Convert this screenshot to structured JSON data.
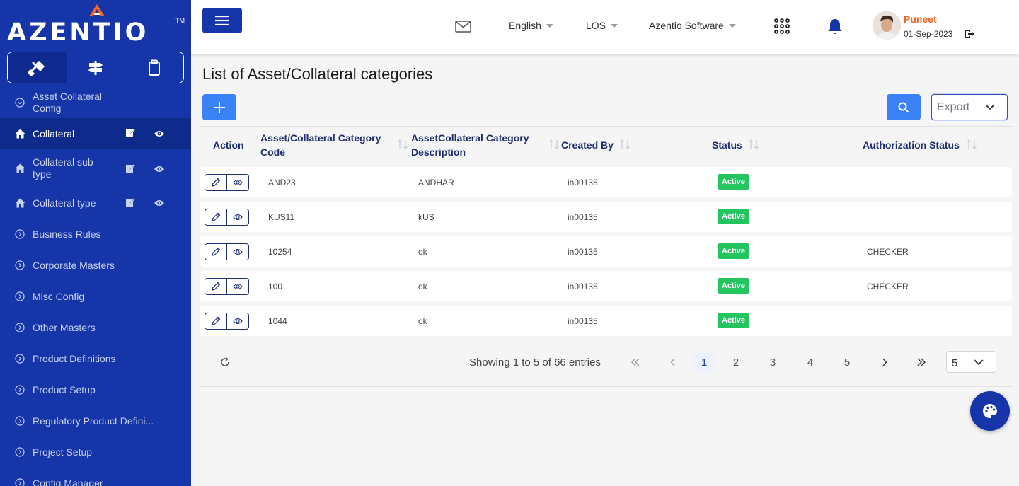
{
  "brand": {
    "name": "AZENTIO",
    "tm": "TM"
  },
  "sidebar": {
    "tabs": [
      {
        "icon": "tools-icon"
      },
      {
        "icon": "signpost-icon"
      },
      {
        "icon": "clipboard-icon"
      }
    ],
    "items": [
      {
        "label": "Asset Collateral Config",
        "icon": "chevron-circle-icon"
      },
      {
        "label": "Collateral",
        "icon": "home-icon",
        "active": true
      },
      {
        "label": "Collateral sub type",
        "icon": "home-icon"
      },
      {
        "label": "Collateral type",
        "icon": "home-icon"
      },
      {
        "label": "Business Rules",
        "icon": "chevron-circle-icon"
      },
      {
        "label": "Corporate Masters",
        "icon": "chevron-circle-icon"
      },
      {
        "label": "Misc Config",
        "icon": "chevron-circle-icon"
      },
      {
        "label": "Other Masters",
        "icon": "chevron-circle-icon"
      },
      {
        "label": "Product Definitions",
        "icon": "chevron-circle-icon"
      },
      {
        "label": "Product Setup",
        "icon": "chevron-circle-icon"
      },
      {
        "label": "Regulatory Product Defini...",
        "icon": "chevron-circle-icon"
      },
      {
        "label": "Project Setup",
        "icon": "chevron-circle-icon"
      },
      {
        "label": "Config Manager",
        "icon": "chevron-circle-icon"
      }
    ]
  },
  "topbar": {
    "language": "English",
    "module": "LOS",
    "company": "Azentio Software",
    "user_name": "Puneet",
    "user_date": "01-Sep-2023"
  },
  "page": {
    "title": "List of Asset/Collateral categories",
    "export_label": "Export"
  },
  "table": {
    "headers": {
      "action": "Action",
      "code": "Asset/Collateral Category Code",
      "description": "AssetCollateral Category Description",
      "created_by": "Created By",
      "status": "Status",
      "auth_status": "Authorization Status"
    },
    "rows": [
      {
        "code": "AND23",
        "description": "ANDHAR",
        "created_by": "in00135",
        "status": "Active",
        "auth_status": ""
      },
      {
        "code": "KUS11",
        "description": "kUS",
        "created_by": "in00135",
        "status": "Active",
        "auth_status": ""
      },
      {
        "code": "10254",
        "description": "ok",
        "created_by": "in00135",
        "status": "Active",
        "auth_status": "CHECKER"
      },
      {
        "code": "100",
        "description": "ok",
        "created_by": "in00135",
        "status": "Active",
        "auth_status": "CHECKER"
      },
      {
        "code": "1044",
        "description": "ok",
        "created_by": "in00135",
        "status": "Active",
        "auth_status": ""
      }
    ]
  },
  "pagination": {
    "summary": "Showing 1 to 5 of 66 entries",
    "pages": [
      "1",
      "2",
      "3",
      "4",
      "5"
    ],
    "current": "1",
    "rows_per_page": "5"
  },
  "colors": {
    "sidebar": "#1535a8",
    "accent": "#3b82f6",
    "active_badge": "#22c55e",
    "user_name": "#f26522"
  }
}
